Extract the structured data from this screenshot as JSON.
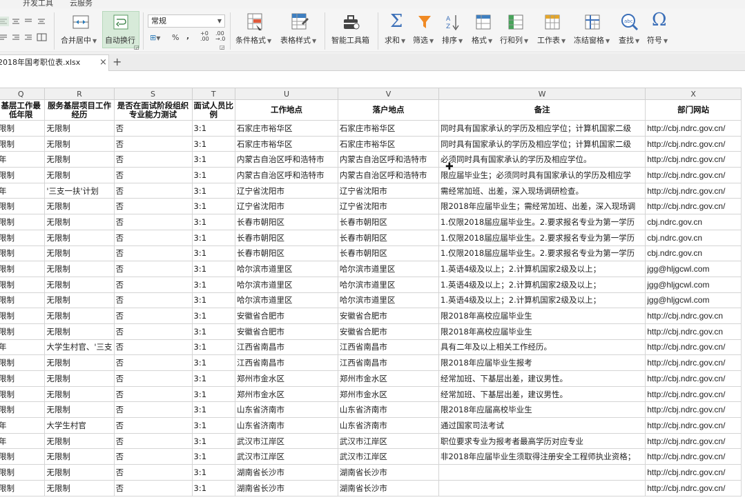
{
  "menu": {
    "items": [
      "开发工具",
      "云服务"
    ]
  },
  "ribbon": {
    "merge_center": "合并居中",
    "wrap_text": "自动换行",
    "number_format": "常规",
    "percent": "%",
    "thousands": ",",
    "cond_format": "条件格式",
    "table_style": "表格样式",
    "smart_toolbox": "智能工具箱",
    "sum": "求和",
    "filter": "筛选",
    "sort": "排序",
    "format": "格式",
    "rows_cols": "行和列",
    "worksheet": "工作表",
    "freeze": "冻结窗格",
    "find": "查找",
    "symbol": "符号"
  },
  "tabs": {
    "file_name": "2018年国考职位表.xlsx",
    "close": "×",
    "new": "+"
  },
  "sheet": {
    "columns": [
      "Q",
      "R",
      "S",
      "T",
      "U",
      "V",
      "W",
      "X"
    ],
    "headers": [
      "基层工作最低年限",
      "服务基层项目工作经历",
      "是否在面试阶段组织专业能力测试",
      "面试人员比例",
      "工作地点",
      "落户地点",
      "备注",
      "部门网站"
    ],
    "rows": [
      [
        "限制",
        "无限制",
        "否",
        "3:1",
        "石家庄市裕华区",
        "石家庄市裕华区",
        "同时具有国家承认的学历及相应学位；计算机国家二级",
        "http://cbj.ndrc.gov.cn/"
      ],
      [
        "限制",
        "无限制",
        "否",
        "3:1",
        "石家庄市裕华区",
        "石家庄市裕华区",
        "同时具有国家承认的学历及相应学位；计算机国家二级",
        "http://cbj.ndrc.gov.cn/"
      ],
      [
        "年",
        "无限制",
        "否",
        "3:1",
        "内蒙古自治区呼和浩特市",
        "内蒙古自治区呼和浩特市",
        "必须同时具有国家承认的学历及相应学位。",
        "http://cbj.ndrc.gov.cn/"
      ],
      [
        "限制",
        "无限制",
        "否",
        "3:1",
        "内蒙古自治区呼和浩特市",
        "内蒙古自治区呼和浩特市",
        "限应届毕业生；必须同时具有国家承认的学历及相应学",
        "http://cbj.ndrc.gov.cn/"
      ],
      [
        "年",
        "'三支一扶'计划",
        "否",
        "3:1",
        "辽宁省沈阳市",
        "辽宁省沈阳市",
        "需经常加班、出差，深入现场调研检查。",
        "http://cbj.ndrc.gov.cn/"
      ],
      [
        "限制",
        "无限制",
        "否",
        "3:1",
        "辽宁省沈阳市",
        "辽宁省沈阳市",
        "限2018年应届毕业生；需经常加班、出差，深入现场调",
        "http://cbj.ndrc.gov.cn/"
      ],
      [
        "限制",
        "无限制",
        "否",
        "3:1",
        "长春市朝阳区",
        "长春市朝阳区",
        "1.仅限2018届应届毕业生。2.要求报名专业为第一学历",
        "cbj.ndrc.gov.cn"
      ],
      [
        "限制",
        "无限制",
        "否",
        "3:1",
        "长春市朝阳区",
        "长春市朝阳区",
        "1.仅限2018届应届毕业生。2.要求报名专业为第一学历",
        "cbj.ndrc.gov.cn"
      ],
      [
        "限制",
        "无限制",
        "否",
        "3:1",
        "长春市朝阳区",
        "长春市朝阳区",
        "1.仅限2018届应届毕业生。2.要求报名专业为第一学历",
        "cbj.ndrc.gov.cn"
      ],
      [
        "限制",
        "无限制",
        "否",
        "3:1",
        "哈尔滨市道里区",
        "哈尔滨市道里区",
        "1.英语4级及以上；2.计算机国家2级及以上；",
        "jgg@hljgcwl.com"
      ],
      [
        "限制",
        "无限制",
        "否",
        "3:1",
        "哈尔滨市道里区",
        "哈尔滨市道里区",
        "1.英语4级及以上；2.计算机国家2级及以上；",
        "jgg@hljgcwl.com"
      ],
      [
        "限制",
        "无限制",
        "否",
        "3:1",
        "哈尔滨市道里区",
        "哈尔滨市道里区",
        "1.英语4级及以上；2.计算机国家2级及以上；",
        "jgg@hljgcwl.com"
      ],
      [
        "限制",
        "无限制",
        "否",
        "3:1",
        "安徽省合肥市",
        "安徽省合肥市",
        "限2018年高校应届毕业生",
        "http://cbj.ndrc.gov.cn"
      ],
      [
        "限制",
        "无限制",
        "否",
        "3:1",
        "安徽省合肥市",
        "安徽省合肥市",
        "限2018年高校应届毕业生",
        "http://cbj.ndrc.gov.cn"
      ],
      [
        "年",
        "大学生村官、'三支",
        "否",
        "3:1",
        "江西省南昌市",
        "江西省南昌市",
        "具有二年及以上相关工作经历。",
        "http://cbj.ndrc.gov.cn/"
      ],
      [
        "限制",
        "无限制",
        "否",
        "3:1",
        "江西省南昌市",
        "江西省南昌市",
        "限2018年应届毕业生报考",
        "http://cbj.ndrc.gov.cn/"
      ],
      [
        "限制",
        "无限制",
        "否",
        "3:1",
        "郑州市金水区",
        "郑州市金水区",
        "经常加班、下基层出差，建议男性。",
        "http://cbj.ndrc.gov.cn/"
      ],
      [
        "限制",
        "无限制",
        "否",
        "3:1",
        "郑州市金水区",
        "郑州市金水区",
        "经常加班、下基层出差，建议男性。",
        "http://cbj.ndrc.gov.cn/"
      ],
      [
        "限制",
        "无限制",
        "否",
        "3:1",
        "山东省济南市",
        "山东省济南市",
        "限2018年应届高校毕业生",
        "http://cbj.ndrc.gov.cn/"
      ],
      [
        "年",
        "大学生村官",
        "否",
        "3:1",
        "山东省济南市",
        "山东省济南市",
        "通过国家司法考试",
        "http://cbj.ndrc.gov.cn/"
      ],
      [
        "年",
        "无限制",
        "否",
        "3:1",
        "武汉市江岸区",
        "武汉市江岸区",
        "职位要求专业为报考者最高学历对应专业",
        "http://cbj.ndrc.gov.cn/"
      ],
      [
        "限制",
        "无限制",
        "否",
        "3:1",
        "武汉市江岸区",
        "武汉市江岸区",
        "非2018年应届毕业生须取得注册安全工程师执业资格；",
        "http://cbj.ndrc.gov.cn/"
      ],
      [
        "限制",
        "无限制",
        "否",
        "3:1",
        "湖南省长沙市",
        "湖南省长沙市",
        "",
        "http://cbj.ndrc.gov.cn/"
      ],
      [
        "限制",
        "无限制",
        "否",
        "3:1",
        "湖南省长沙市",
        "湖南省长沙市",
        "",
        "http://cbj.ndrc.gov.cn/"
      ]
    ]
  }
}
